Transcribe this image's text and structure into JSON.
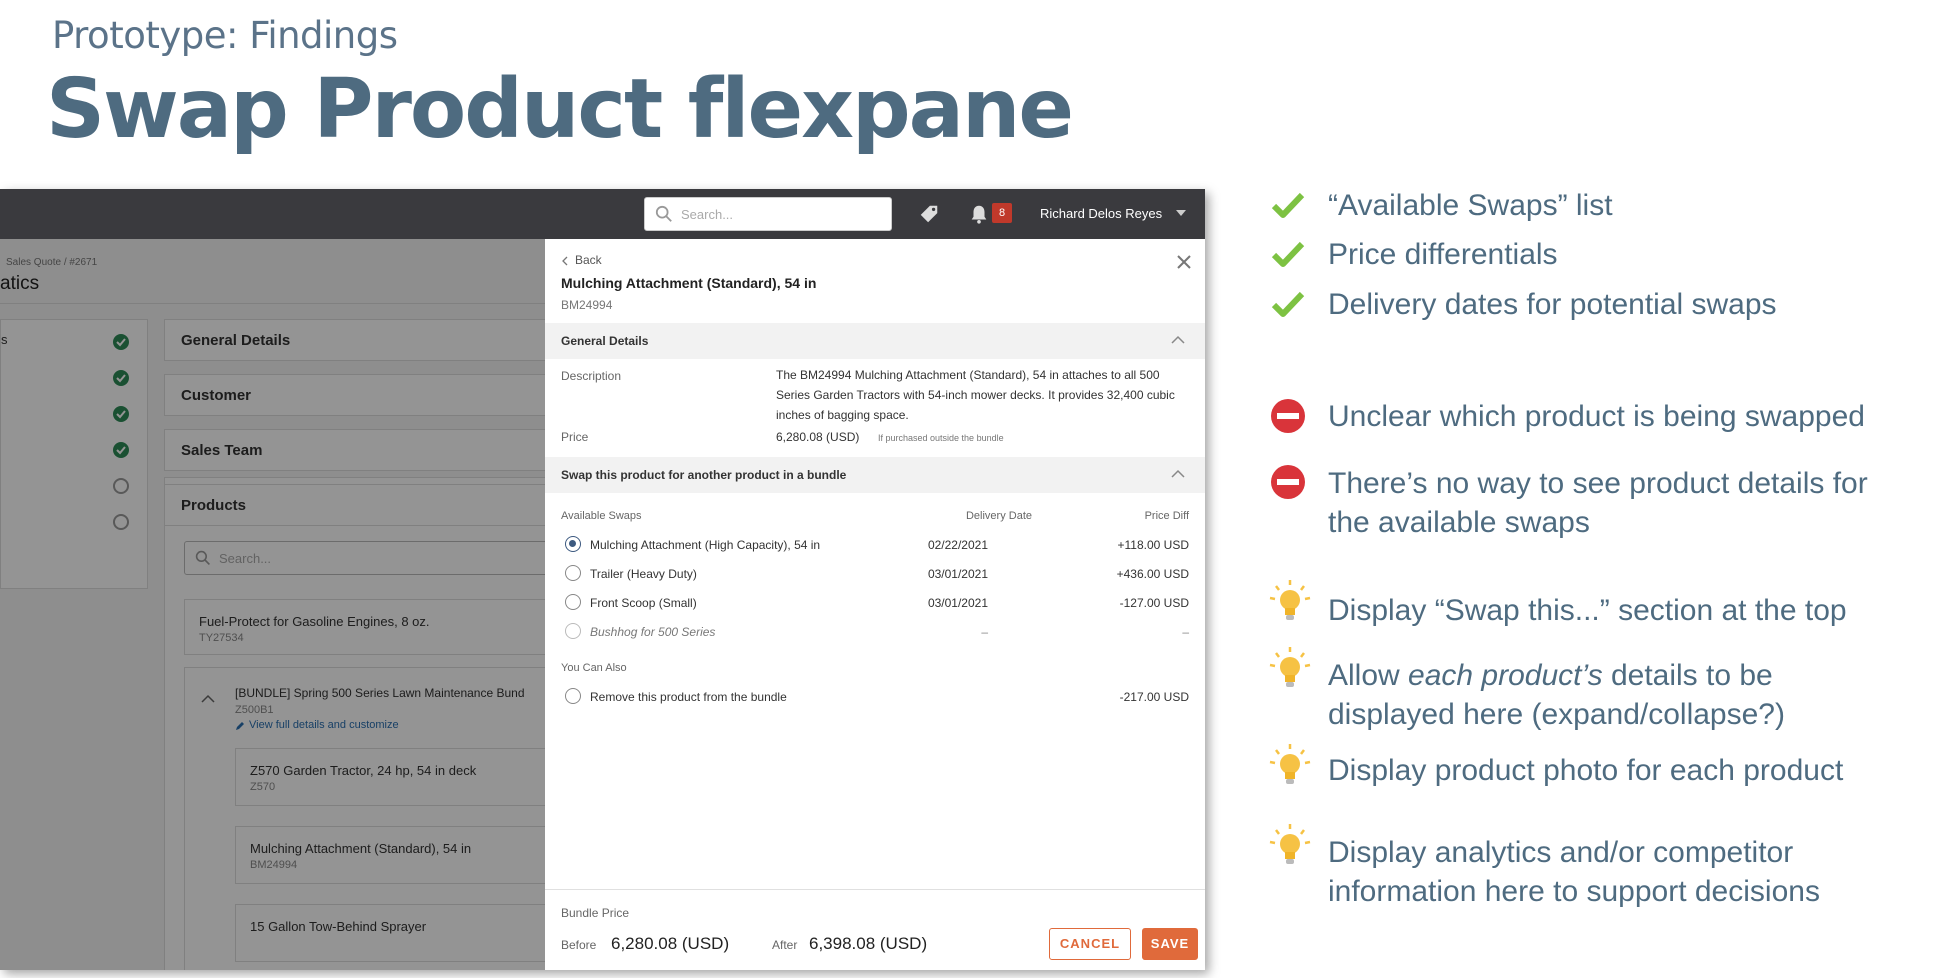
{
  "header": {
    "subtitle": "Prototype: Findings",
    "title": "Swap Product flexpane"
  },
  "topbar": {
    "search_placeholder": "Search...",
    "notification_count": "8",
    "user_name": "Richard Delos Reyes"
  },
  "background_app": {
    "breadcrumb": "Sales Quote / #2671",
    "page_title": "atics",
    "steps": [
      {
        "label": "s",
        "status": "done"
      },
      {
        "label": "",
        "status": "done"
      },
      {
        "label": "",
        "status": "done"
      },
      {
        "label": "",
        "status": "done"
      },
      {
        "label": "",
        "status": "todo"
      },
      {
        "label": "",
        "status": "todo"
      }
    ],
    "sections": [
      "General Details",
      "Customer",
      "Sales Team",
      "Products"
    ],
    "products_search_placeholder": "Search...",
    "products": [
      {
        "name": "Fuel-Protect for Gasoline Engines, 8 oz.",
        "sku": "TY27534"
      },
      {
        "name": "[BUNDLE] Spring 500 Series Lawn Maintenance Bund",
        "sku": "Z500B1",
        "link": "View full details and customize"
      },
      {
        "name": "Z570 Garden Tractor, 24 hp, 54 in deck",
        "sku": "Z570"
      },
      {
        "name": "Mulching Attachment (Standard), 54 in",
        "sku": "BM24994"
      },
      {
        "name": "15 Gallon Tow-Behind Sprayer",
        "sku": ""
      }
    ]
  },
  "flexpane": {
    "back_label": "Back",
    "product_name": "Mulching Attachment (Standard), 54 in",
    "product_sku": "BM24994",
    "general_details_heading": "General Details",
    "description_label": "Description",
    "description_text": "The BM24994 Mulching Attachment (Standard), 54 in attaches to all 500 Series Garden Tractors with 54-inch mower decks. It provides 32,400 cubic inches of bagging space.",
    "price_label": "Price",
    "price_value": "6,280.08 (USD)",
    "price_note": "If purchased outside the bundle",
    "swap_heading": "Swap this product for another product in a bundle",
    "col_available": "Available Swaps",
    "col_date": "Delivery Date",
    "col_diff": "Price Diff",
    "swaps": [
      {
        "name": "Mulching Attachment (High Capacity), 54 in",
        "date": "02/22/2021",
        "diff": "+118.00 USD",
        "selected": true
      },
      {
        "name": "Trailer (Heavy Duty)",
        "date": "03/01/2021",
        "diff": "+436.00 USD",
        "selected": false
      },
      {
        "name": "Front Scoop (Small)",
        "date": "03/01/2021",
        "diff": "-127.00 USD",
        "selected": false
      },
      {
        "name": "Bushhog for 500 Series",
        "date": "–",
        "diff": "–",
        "selected": false
      }
    ],
    "also_label": "You Can Also",
    "remove_label": "Remove this product from the bundle",
    "remove_diff": "-217.00 USD",
    "bundle_price_label": "Bundle Price",
    "before_label": "Before",
    "before_value": "6,280.08 (USD)",
    "after_label": "After",
    "after_value": "6,398.08 (USD)",
    "cancel_label": "CANCEL",
    "save_label": "SAVE"
  },
  "findings": [
    {
      "type": "check",
      "lines": [
        "“Available Swaps” list"
      ]
    },
    {
      "type": "check",
      "lines": [
        "Price differentials"
      ]
    },
    {
      "type": "check",
      "lines": [
        "Delivery dates for potential swaps"
      ]
    },
    {
      "type": "stop",
      "lines": [
        "Unclear which product is being swapped"
      ]
    },
    {
      "type": "stop",
      "lines": [
        "There’s no way to see product details for",
        "the available swaps"
      ]
    },
    {
      "type": "idea",
      "lines": [
        "Display “Swap this...” section at the top"
      ]
    },
    {
      "type": "idea",
      "pre": "Allow ",
      "em": "each product’s",
      "post": " details to be",
      "line2": "displayed here (expand/collapse?)"
    },
    {
      "type": "idea",
      "lines": [
        "Display product photo for each product"
      ]
    },
    {
      "type": "idea",
      "lines": [
        "Display analytics and/or competitor",
        "information here to support decisions"
      ]
    }
  ],
  "colors": {
    "title": "#4e6b80",
    "accent_orange": "#e06a3b",
    "check_green": "#7dc242",
    "stop_red": "#d9343a",
    "bulb_yellow": "#f6c244",
    "topbar": "#3a3a3e"
  }
}
